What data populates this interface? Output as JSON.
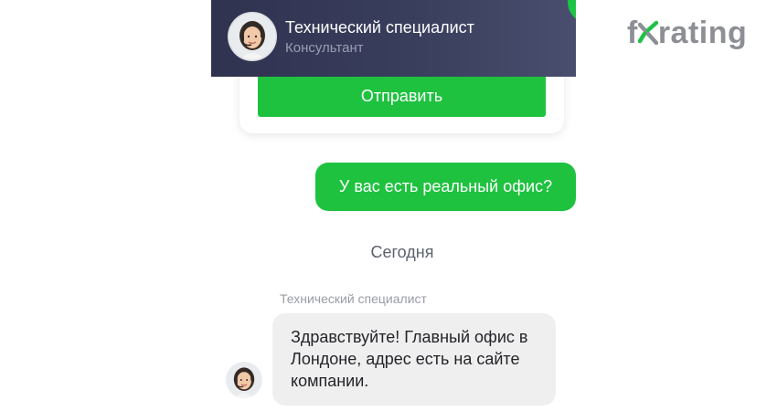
{
  "header": {
    "title": "Технический специалист",
    "subtitle": "Консультант",
    "avatar_icon": "support-agent-avatar",
    "status_color": "#1ec246",
    "background_color": "#353957"
  },
  "logo": {
    "text_before": "f",
    "text_after": "rating",
    "mark_icon": "fx-check-mark-icon",
    "mark_color": "#1ec246"
  },
  "form": {
    "send_label": "Отправить"
  },
  "messages": {
    "outgoing": {
      "text": "У вас есть реальный офис?"
    },
    "date_separator": "Сегодня",
    "incoming": {
      "sender": "Технический специалист",
      "text": "Здравствуйте! Главный офис в Лондоне, адрес есть на сайте компании.",
      "avatar_icon": "support-agent-avatar"
    }
  },
  "colors": {
    "accent_green": "#1ec23f",
    "bubble_incoming": "#f0eff0"
  }
}
